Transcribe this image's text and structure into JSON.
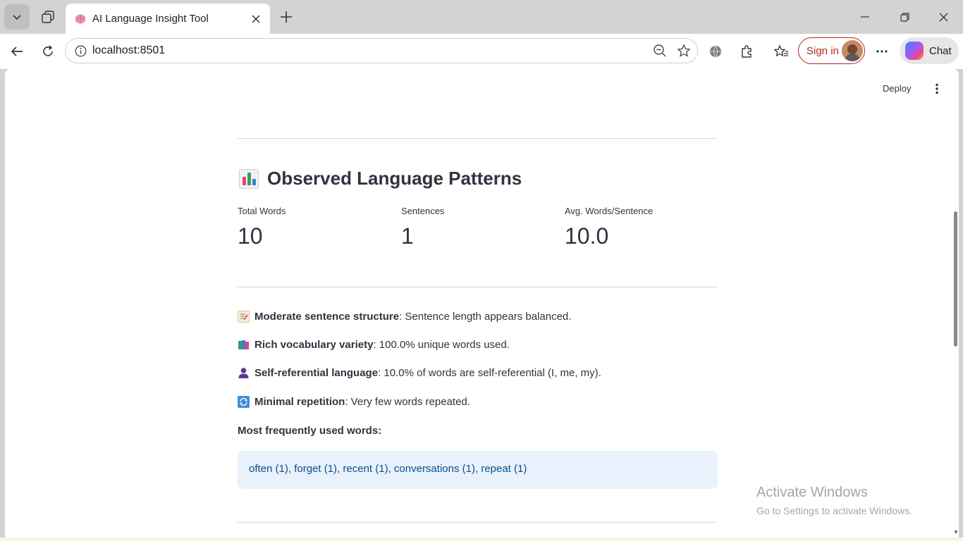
{
  "browser": {
    "tab_title": "AI Language Insight Tool",
    "url": "localhost:8501",
    "sign_in_label": "Sign in",
    "chat_label": "Chat"
  },
  "app": {
    "deploy_label": "Deploy",
    "heading": "Observed Language Patterns",
    "metrics": [
      {
        "label": "Total Words",
        "value": "10"
      },
      {
        "label": "Sentences",
        "value": "1"
      },
      {
        "label": "Avg. Words/Sentence",
        "value": "10.0"
      }
    ],
    "patterns": [
      {
        "title": "Moderate sentence structure",
        "text": ": Sentence length appears balanced.",
        "icon": "memo-icon"
      },
      {
        "title": "Rich vocabulary variety",
        "text": ": 100.0% unique words used.",
        "icon": "books-icon"
      },
      {
        "title": "Self-referential language",
        "text": ": 10.0% of words are self-referential (I, me, my).",
        "icon": "person-icon"
      },
      {
        "title": "Minimal repetition",
        "text": ": Very few words repeated.",
        "icon": "repeat-icon"
      }
    ],
    "frequent_title": "Most frequently used words:",
    "frequent_words": "often (1), forget (1), recent (1), conversations (1), repeat (1)"
  },
  "watermark": {
    "title": "Activate Windows",
    "subtitle": "Go to Settings to activate Windows."
  },
  "colors": {
    "accent_red": "#b3261e",
    "info_bg": "#e8f1fc",
    "info_text": "#0b4f8c"
  }
}
